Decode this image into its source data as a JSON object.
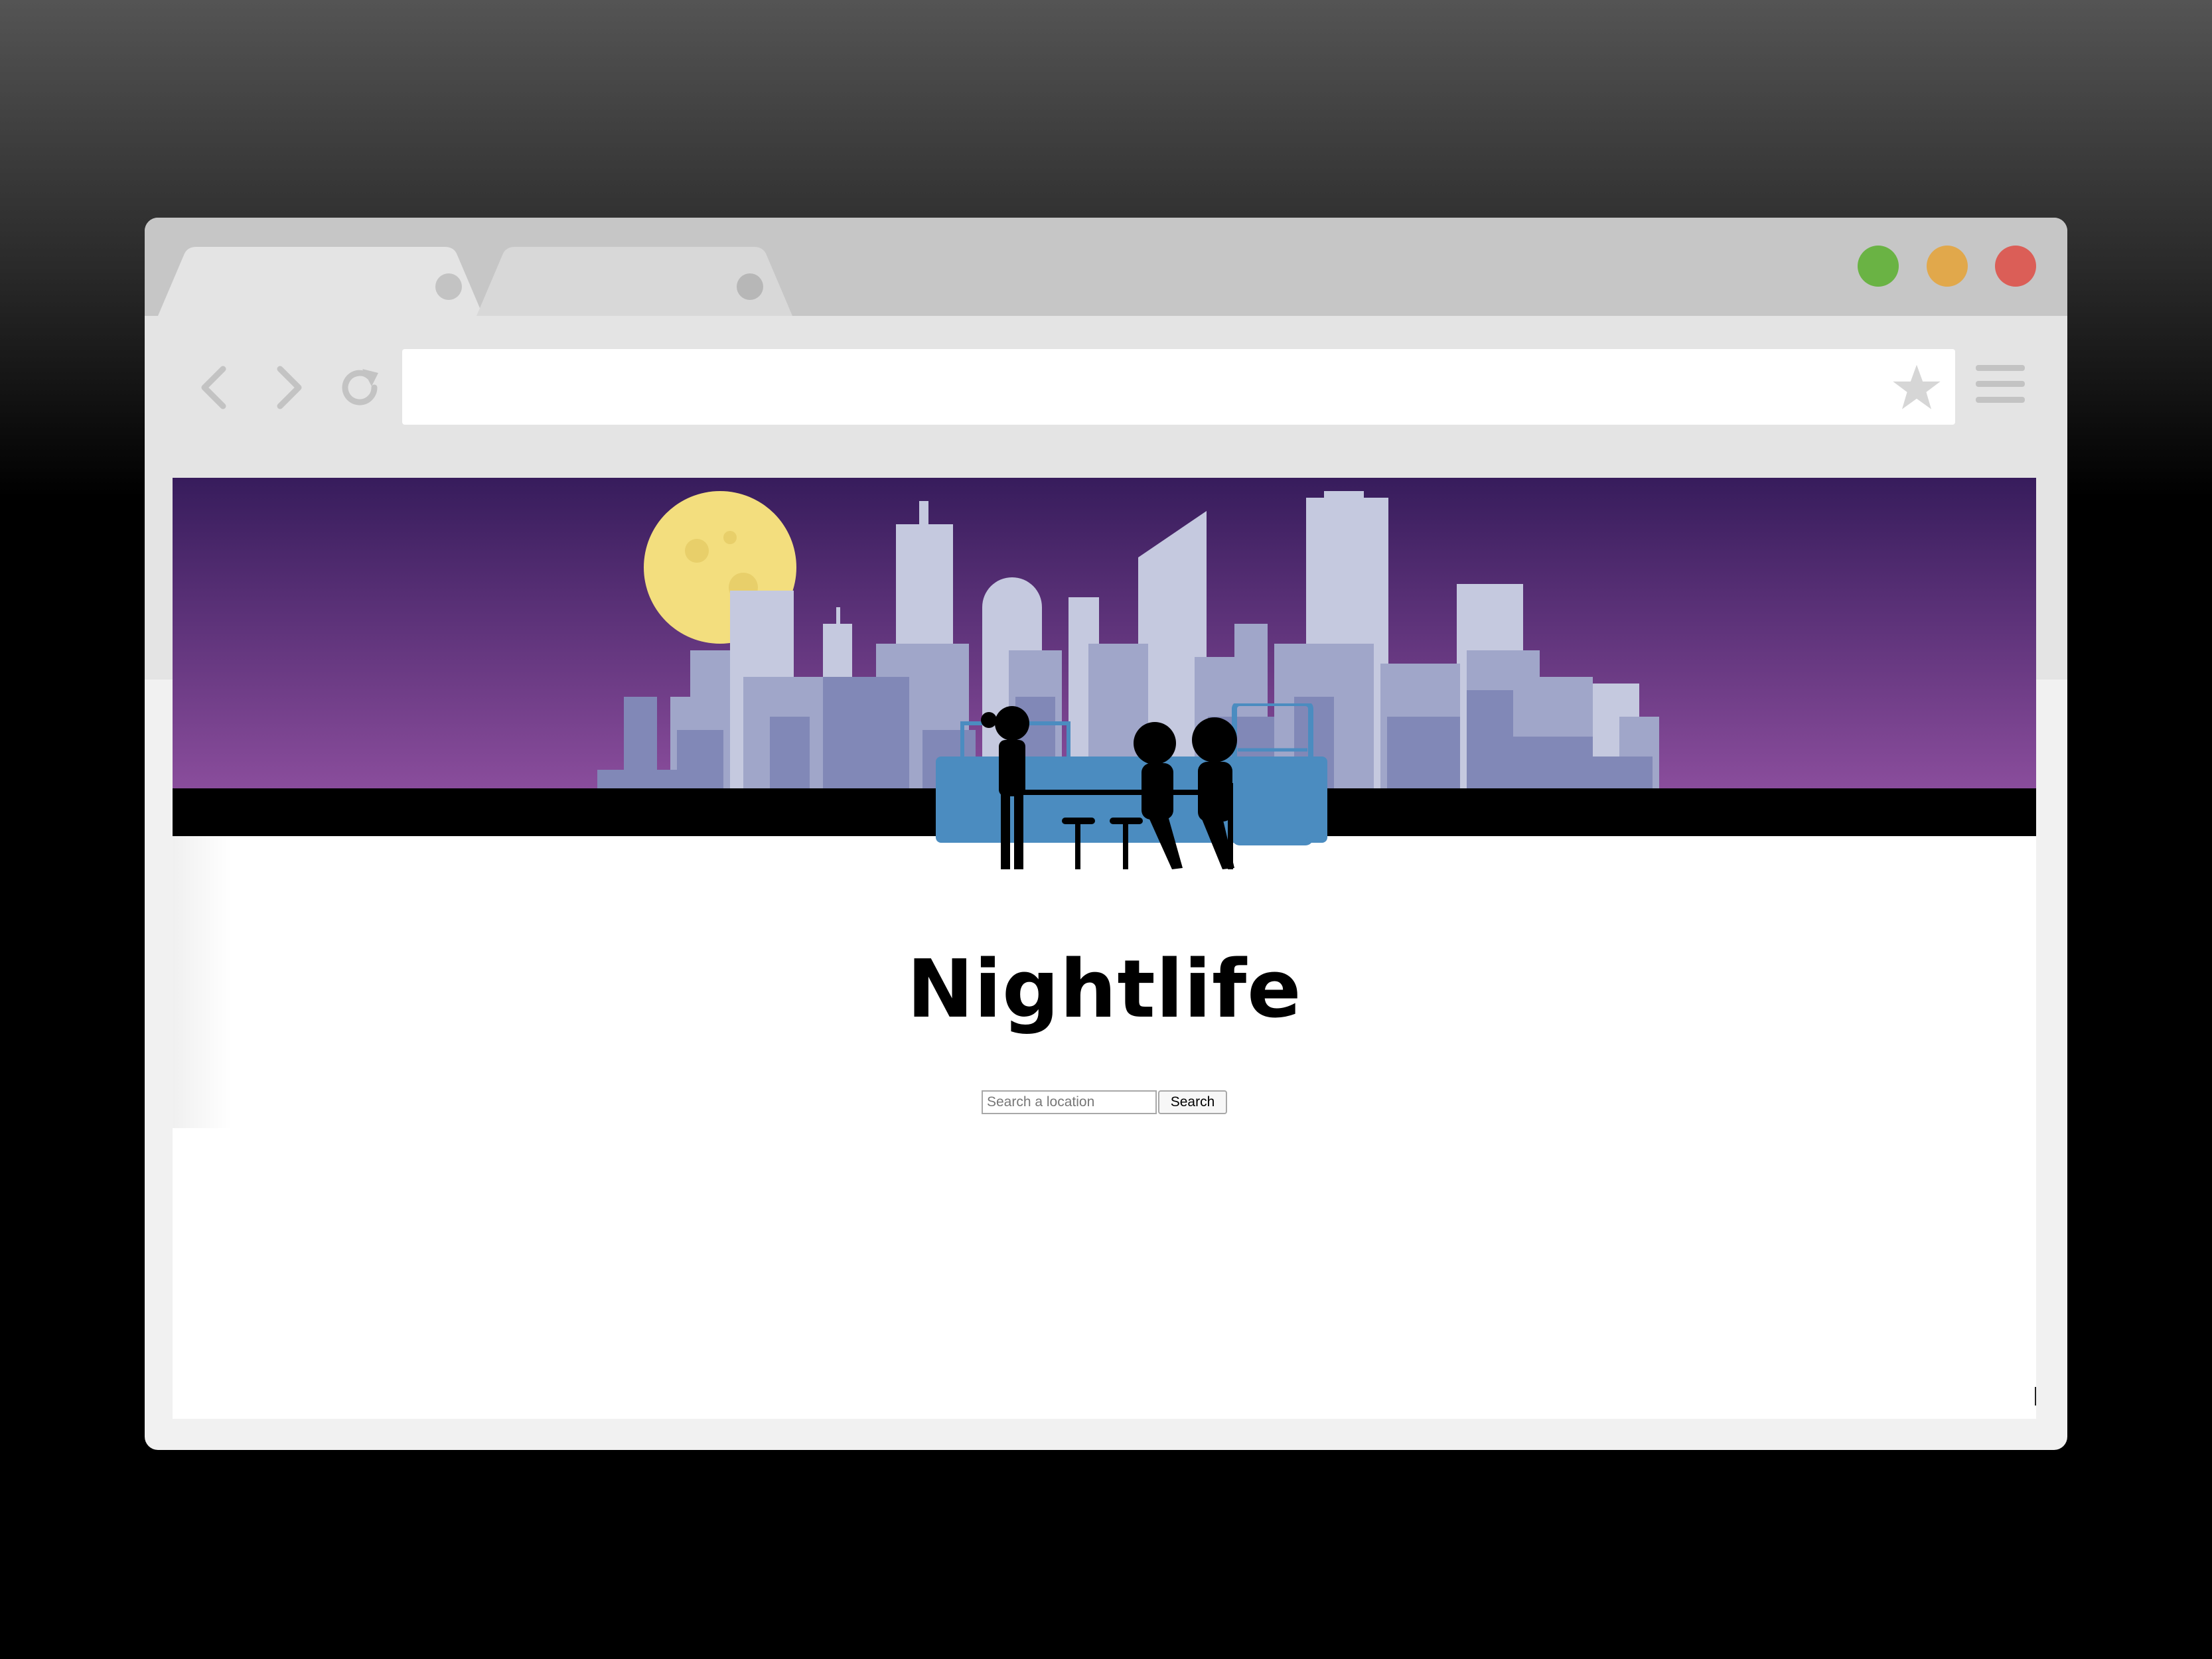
{
  "browser": {
    "window_controls": [
      "green-dot",
      "yellow-dot",
      "red-dot"
    ],
    "nav_icons": [
      "back-arrow-icon",
      "forward-arrow-icon",
      "reload-icon"
    ],
    "address_value": "",
    "star_icon": "star-icon",
    "menu_icon": "hamburger-menu-icon"
  },
  "page": {
    "title": "Nightlife",
    "search": {
      "placeholder": "Search a location",
      "button_label": "Search"
    }
  },
  "colors": {
    "sky_top": "#371c5c",
    "sky_bottom": "#8a4d9c",
    "moon": "#f3de7e",
    "building_light": "#c5c9df",
    "building_mid": "#a0a6c9",
    "building_dark": "#8188b7",
    "bar_counter": "#4b8cc0",
    "green": "#6ab344",
    "yellow": "#e1a84b",
    "red": "#db5e57"
  }
}
